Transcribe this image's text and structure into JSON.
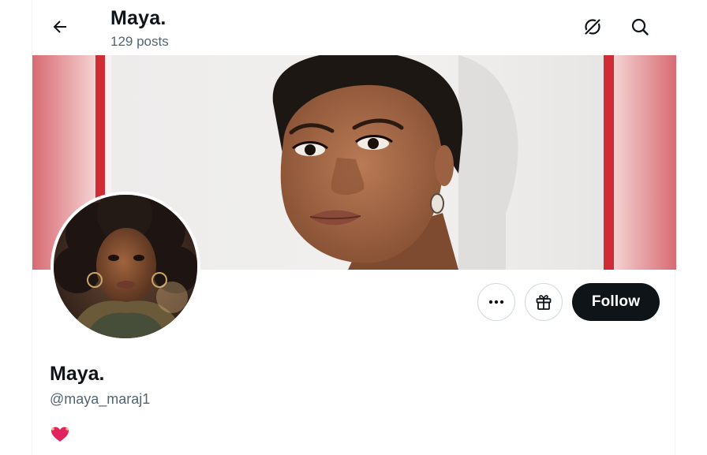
{
  "header": {
    "title": "Maya.",
    "posts_count": "129 posts"
  },
  "profile": {
    "display_name": "Maya.",
    "handle": "@maya_maraj1",
    "bio_emoji": "heart-with-ribbon"
  },
  "actions": {
    "more_icon": "more-horizontal-icon",
    "gift_icon": "gift-icon",
    "follow_label": "Follow"
  },
  "icons": {
    "back": "arrow-left-icon",
    "grok": "grok-icon",
    "search": "search-icon"
  },
  "colors": {
    "text_primary": "#0f1419",
    "text_secondary": "#536471",
    "follow_bg": "#0f1419",
    "border": "#cfd9de",
    "banner_stripe": "#d32f3a",
    "heart": "#e0245e"
  }
}
